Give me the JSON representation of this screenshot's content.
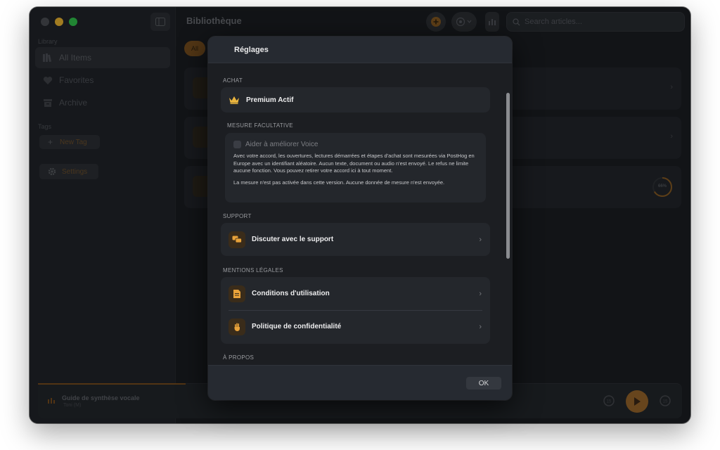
{
  "sidebar": {
    "library_label": "Library",
    "items": [
      {
        "label": "All Items",
        "icon": "books-icon",
        "active": true
      },
      {
        "label": "Favorites",
        "icon": "heart-icon",
        "active": false
      },
      {
        "label": "Archive",
        "icon": "archive-icon",
        "active": false
      }
    ],
    "tags_label": "Tags",
    "new_tag_label": "New Tag",
    "settings_label": "Settings"
  },
  "toolbar": {
    "title": "Bibliothèque",
    "search_placeholder": "Search articles..."
  },
  "content": {
    "filter_all": "All",
    "progress_label": "66%"
  },
  "player": {
    "title": "Guide de synthèse vocale",
    "subtitle": "Toni (M)"
  },
  "modal": {
    "title": "Réglages",
    "sections": {
      "purchase": "ACHAT",
      "optional_measurement": "MESURE FACULTATIVE",
      "support": "SUPPORT",
      "legal": "MENTIONS LÉGALES",
      "about": "À PROPOS"
    },
    "premium_label": "Premium Actif",
    "measurement": {
      "checkbox_label": "Aider à améliorer Voice",
      "checked": false,
      "description": "Avec votre accord, les ouvertures, lectures démarrées et étapes d'achat sont mesurées via PostHog en Europe avec un identifiant aléatoire. Aucun texte, document ou audio n'est envoyé. Le refus ne limite aucune fonction. Vous pouvez retirer votre accord ici à tout moment.",
      "note": "La mesure n'est pas activée dans cette version. Aucune donnée de mesure n'est envoyée."
    },
    "support_chat_label": "Discuter avec le support",
    "terms_label": "Conditions d'utilisation",
    "privacy_label": "Politique de confidentialité",
    "ok_label": "OK"
  },
  "colors": {
    "accent": "#e8a23a",
    "window_bg": "#17191c",
    "modal_bg": "#1c1e22"
  }
}
